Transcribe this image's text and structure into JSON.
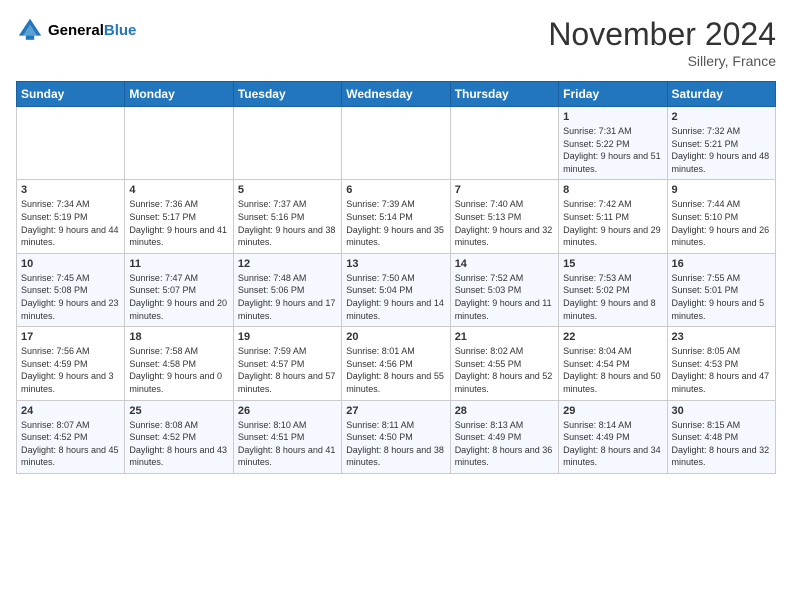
{
  "header": {
    "logo_line1": "General",
    "logo_line2": "Blue",
    "month": "November 2024",
    "location": "Sillery, France"
  },
  "weekdays": [
    "Sunday",
    "Monday",
    "Tuesday",
    "Wednesday",
    "Thursday",
    "Friday",
    "Saturday"
  ],
  "weeks": [
    [
      {
        "day": "",
        "info": ""
      },
      {
        "day": "",
        "info": ""
      },
      {
        "day": "",
        "info": ""
      },
      {
        "day": "",
        "info": ""
      },
      {
        "day": "",
        "info": ""
      },
      {
        "day": "1",
        "info": "Sunrise: 7:31 AM\nSunset: 5:22 PM\nDaylight: 9 hours and 51 minutes."
      },
      {
        "day": "2",
        "info": "Sunrise: 7:32 AM\nSunset: 5:21 PM\nDaylight: 9 hours and 48 minutes."
      }
    ],
    [
      {
        "day": "3",
        "info": "Sunrise: 7:34 AM\nSunset: 5:19 PM\nDaylight: 9 hours and 44 minutes."
      },
      {
        "day": "4",
        "info": "Sunrise: 7:36 AM\nSunset: 5:17 PM\nDaylight: 9 hours and 41 minutes."
      },
      {
        "day": "5",
        "info": "Sunrise: 7:37 AM\nSunset: 5:16 PM\nDaylight: 9 hours and 38 minutes."
      },
      {
        "day": "6",
        "info": "Sunrise: 7:39 AM\nSunset: 5:14 PM\nDaylight: 9 hours and 35 minutes."
      },
      {
        "day": "7",
        "info": "Sunrise: 7:40 AM\nSunset: 5:13 PM\nDaylight: 9 hours and 32 minutes."
      },
      {
        "day": "8",
        "info": "Sunrise: 7:42 AM\nSunset: 5:11 PM\nDaylight: 9 hours and 29 minutes."
      },
      {
        "day": "9",
        "info": "Sunrise: 7:44 AM\nSunset: 5:10 PM\nDaylight: 9 hours and 26 minutes."
      }
    ],
    [
      {
        "day": "10",
        "info": "Sunrise: 7:45 AM\nSunset: 5:08 PM\nDaylight: 9 hours and 23 minutes."
      },
      {
        "day": "11",
        "info": "Sunrise: 7:47 AM\nSunset: 5:07 PM\nDaylight: 9 hours and 20 minutes."
      },
      {
        "day": "12",
        "info": "Sunrise: 7:48 AM\nSunset: 5:06 PM\nDaylight: 9 hours and 17 minutes."
      },
      {
        "day": "13",
        "info": "Sunrise: 7:50 AM\nSunset: 5:04 PM\nDaylight: 9 hours and 14 minutes."
      },
      {
        "day": "14",
        "info": "Sunrise: 7:52 AM\nSunset: 5:03 PM\nDaylight: 9 hours and 11 minutes."
      },
      {
        "day": "15",
        "info": "Sunrise: 7:53 AM\nSunset: 5:02 PM\nDaylight: 9 hours and 8 minutes."
      },
      {
        "day": "16",
        "info": "Sunrise: 7:55 AM\nSunset: 5:01 PM\nDaylight: 9 hours and 5 minutes."
      }
    ],
    [
      {
        "day": "17",
        "info": "Sunrise: 7:56 AM\nSunset: 4:59 PM\nDaylight: 9 hours and 3 minutes."
      },
      {
        "day": "18",
        "info": "Sunrise: 7:58 AM\nSunset: 4:58 PM\nDaylight: 9 hours and 0 minutes."
      },
      {
        "day": "19",
        "info": "Sunrise: 7:59 AM\nSunset: 4:57 PM\nDaylight: 8 hours and 57 minutes."
      },
      {
        "day": "20",
        "info": "Sunrise: 8:01 AM\nSunset: 4:56 PM\nDaylight: 8 hours and 55 minutes."
      },
      {
        "day": "21",
        "info": "Sunrise: 8:02 AM\nSunset: 4:55 PM\nDaylight: 8 hours and 52 minutes."
      },
      {
        "day": "22",
        "info": "Sunrise: 8:04 AM\nSunset: 4:54 PM\nDaylight: 8 hours and 50 minutes."
      },
      {
        "day": "23",
        "info": "Sunrise: 8:05 AM\nSunset: 4:53 PM\nDaylight: 8 hours and 47 minutes."
      }
    ],
    [
      {
        "day": "24",
        "info": "Sunrise: 8:07 AM\nSunset: 4:52 PM\nDaylight: 8 hours and 45 minutes."
      },
      {
        "day": "25",
        "info": "Sunrise: 8:08 AM\nSunset: 4:52 PM\nDaylight: 8 hours and 43 minutes."
      },
      {
        "day": "26",
        "info": "Sunrise: 8:10 AM\nSunset: 4:51 PM\nDaylight: 8 hours and 41 minutes."
      },
      {
        "day": "27",
        "info": "Sunrise: 8:11 AM\nSunset: 4:50 PM\nDaylight: 8 hours and 38 minutes."
      },
      {
        "day": "28",
        "info": "Sunrise: 8:13 AM\nSunset: 4:49 PM\nDaylight: 8 hours and 36 minutes."
      },
      {
        "day": "29",
        "info": "Sunrise: 8:14 AM\nSunset: 4:49 PM\nDaylight: 8 hours and 34 minutes."
      },
      {
        "day": "30",
        "info": "Sunrise: 8:15 AM\nSunset: 4:48 PM\nDaylight: 8 hours and 32 minutes."
      }
    ]
  ]
}
